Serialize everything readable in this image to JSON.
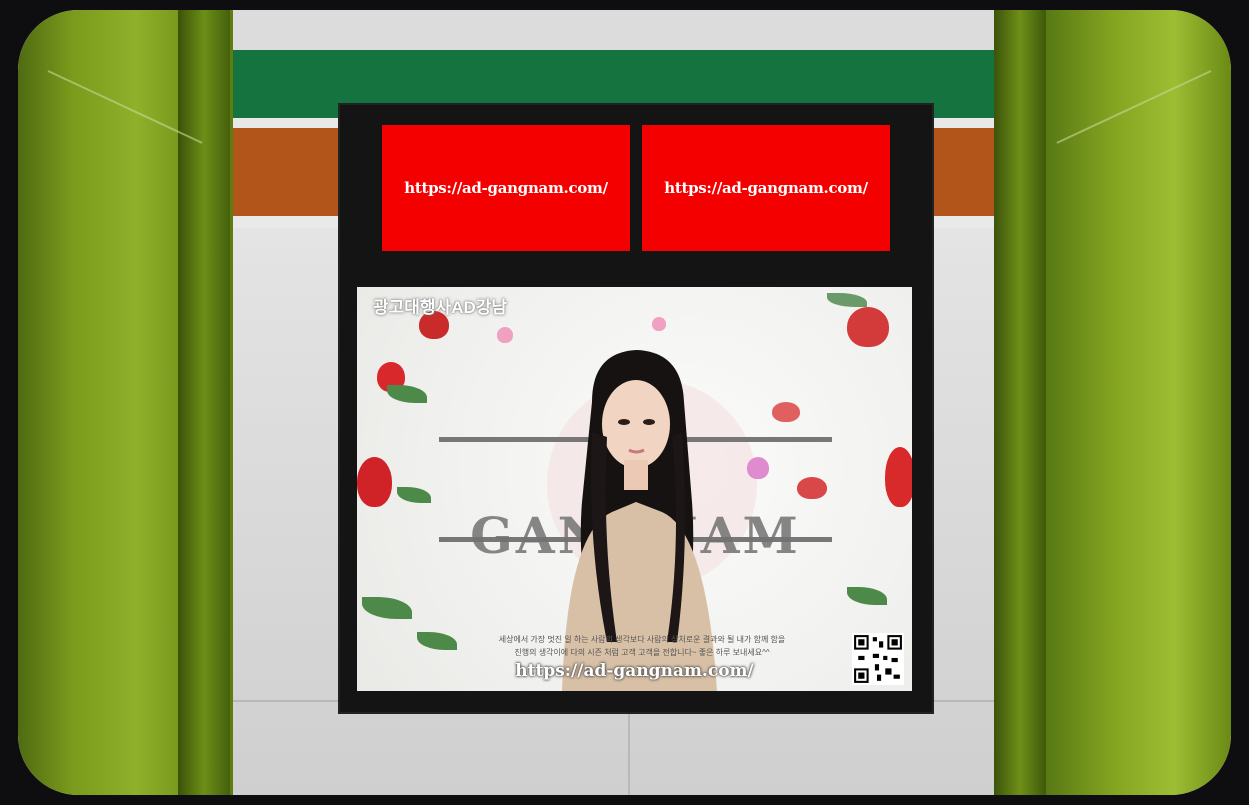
{
  "banners": [
    {
      "text": "https://ad-gangnam.com/"
    },
    {
      "text": "https://ad-gangnam.com/"
    }
  ],
  "poster": {
    "brand": "광고대행사AD강남",
    "logo": "AD GANGNAM",
    "caption_line1": "세상에서 가장 멋진 일 하는 사람의 생각보다 사람의 상처로운 결과와 될 내가 함께 함을",
    "caption_line2": "진행의 생각이에 다의 시즌 처럼 고객 고객을 전합니다~ 좋은 하루 보내세요^^",
    "url": "https://ad-gangnam.com/"
  },
  "colors": {
    "banner_red": "#f40000",
    "station_green": "#15733f",
    "station_orange": "#b2551b",
    "pillar_green": "#8fb02a"
  }
}
